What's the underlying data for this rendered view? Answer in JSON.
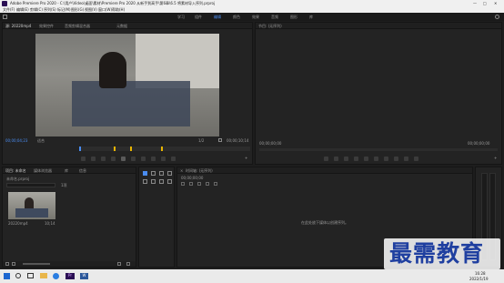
{
  "title": "Adobe Premiere Pro 2020 - C:\\用户\\Video\\桌面\\素材\\Premiere Pro 2020 从新手到高手\\第6章\\6.5 将素材导入序列.prproj",
  "window_controls": {
    "minimize": "—",
    "maximize": "□",
    "close": "✕"
  },
  "menu": [
    "文件(F)",
    "编辑(E)",
    "剪辑(C)",
    "序列(S)",
    "标记(M)",
    "图形(G)",
    "视图(V)",
    "窗口(W)",
    "帮助(H)"
  ],
  "workspaces": [
    "学习",
    "组件",
    "编辑",
    "颜色",
    "效果",
    "音频",
    "图形",
    "库"
  ],
  "source_panel": {
    "tabs": [
      "源: 20220mp4",
      "效果控件",
      "音频剪辑混合器",
      "元数据"
    ],
    "timecode": "00;00;04;23",
    "fit": "适合",
    "fraction": "1/2",
    "duration": "00;00;10;14"
  },
  "program_panel": {
    "tab": "节目: (无序列)",
    "timecode_left": "00;00;00;00",
    "timecode_right": "00;00;00;00"
  },
  "project_panel": {
    "tabs": [
      "项目: 未命名",
      "媒体浏览器",
      "库",
      "信息"
    ],
    "filename": "未命名.prproj",
    "count": "1项",
    "clip_name": "20220mp4",
    "clip_duration": "10;14"
  },
  "timeline_panel": {
    "tab": "时间轴: (无序列)",
    "timecode": "00;00;00;00",
    "empty_message": "在此处放下媒体以创建序列。"
  },
  "taskbar": {
    "time": "16:28",
    "date": "2022/1/19",
    "apps": [
      "Pr",
      "W"
    ]
  },
  "watermark": "最需教育",
  "colors": {
    "accent": "#4a8cf0",
    "marker": "#e8b400",
    "panel": "#232323"
  }
}
